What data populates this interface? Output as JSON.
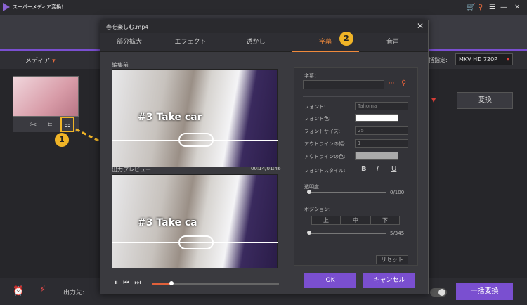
{
  "app": {
    "title": "スーパーメディア変換！",
    "add_media": "メディア",
    "batch_label": "一括指定:",
    "profile": "MKV HD 720P",
    "convert": "変換",
    "output_label": "出力先:",
    "batch_convert": "一括変換"
  },
  "dialog": {
    "title": "春を楽しむ.mp4",
    "tabs": [
      "部分拡大",
      "エフェクト",
      "透かし",
      "字幕",
      "音声"
    ],
    "active_tab": "字幕",
    "before_label": "編集前",
    "preview_label": "出力プレビュー",
    "preview_time": "00:14/01:46",
    "watermark_top": "#3 Take car",
    "watermark_bottom": "#3 Take ca",
    "panel": {
      "subtitle_label": "字幕：",
      "font_label": "フォント:",
      "font_value": "Tahoma",
      "font_color_label": "フォント色:",
      "font_size_label": "フォントサイズ:",
      "font_size_value": "25",
      "outline_width_label": "アウトラインの幅:",
      "outline_width_value": "1",
      "outline_color_label": "アウトラインの色:",
      "font_style_label": "フォントスタイル:",
      "bold": "B",
      "italic": "I",
      "underline": "U",
      "opacity_label": "透明度",
      "opacity_value": "0/100",
      "position_label": "ポジション:",
      "pos_up": "上",
      "pos_mid": "中",
      "pos_down": "下",
      "position_value": "5/345",
      "reset": "リセット"
    },
    "ok": "OK",
    "cancel": "キャンセル"
  },
  "callouts": {
    "one": "1",
    "two": "2"
  },
  "colors": {
    "accent": "#7a4fd0",
    "active_tab": "#f08a3c",
    "callout": "#f0b427"
  }
}
